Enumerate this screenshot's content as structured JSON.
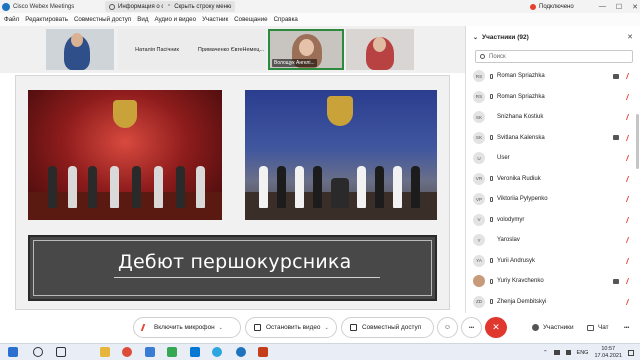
{
  "window": {
    "app_title": "Cisco Webex Meetings",
    "meeting_info": "Информация о совещании",
    "hide_menu": "Скрыть строку меню",
    "connection_status": "Подключено",
    "minimize": "—",
    "maximize": "☐",
    "close": "✕"
  },
  "menu": [
    "Файл",
    "Редактировать",
    "Совместный доступ",
    "Вид",
    "Аудио и видео",
    "Участник",
    "Совещание",
    "Справка"
  ],
  "video_strip": {
    "tiles": [
      {
        "name": ""
      },
      {
        "name": "Наталія Пасічник"
      },
      {
        "name": "Примаченко ЄвгеНемец..."
      },
      {
        "name": "Волощук Ангелі..."
      },
      {
        "name": ""
      }
    ]
  },
  "slide": {
    "title": "Дебют першокурсника"
  },
  "participants": {
    "header": "Участники (92)",
    "search_placeholder": "Поиск",
    "items": [
      {
        "initials": "RS",
        "name": "Roman Spriazhka",
        "device": "phone",
        "camera": true,
        "mic_muted": true
      },
      {
        "initials": "RS",
        "name": "Roman Spriazhka",
        "device": "phone",
        "camera": false,
        "mic_muted": true
      },
      {
        "initials": "SK",
        "name": "Snizhana Kostiuk",
        "device": "",
        "camera": false,
        "mic_muted": true
      },
      {
        "initials": "SK",
        "name": "Svitlana Kalenska",
        "device": "phone",
        "camera": true,
        "mic_muted": true
      },
      {
        "initials": "U",
        "name": "User",
        "device": "",
        "camera": false,
        "mic_muted": true
      },
      {
        "initials": "VR",
        "name": "Veronika Rudiuk",
        "device": "phone",
        "camera": false,
        "mic_muted": true
      },
      {
        "initials": "VP",
        "name": "Viktoriia Pylypenko",
        "device": "phone",
        "camera": false,
        "mic_muted": true
      },
      {
        "initials": "V",
        "name": "volodymyr",
        "device": "phone",
        "camera": false,
        "mic_muted": true
      },
      {
        "initials": "Y",
        "name": "Yaroslav",
        "device": "",
        "camera": false,
        "mic_muted": true
      },
      {
        "initials": "YA",
        "name": "Yurii Andrusyk",
        "device": "phone",
        "camera": false,
        "mic_muted": true
      },
      {
        "initials": "",
        "name": "Yuriy Kravchenko",
        "device": "phone",
        "camera": true,
        "mic_muted": true,
        "photo": true
      },
      {
        "initials": "ZD",
        "name": "Zhenja Dembitskyi",
        "device": "phone",
        "camera": false,
        "mic_muted": true
      }
    ]
  },
  "controls": {
    "mic_label": "Включить микрофон",
    "video_label": "Остановить видео",
    "share_label": "Совместный доступ",
    "participants_label": "Участники",
    "chat_label": "Чат",
    "more": "•••",
    "caret": "⌄"
  },
  "taskbar": {
    "lang": "ENG",
    "time": "10:57",
    "date": "17.04.2021"
  },
  "colors": {
    "end_call": "#e0372f",
    "mic_muted": "#e24a3b",
    "active_speaker_border": "#2b8a3e",
    "slide_title_bg": "#484848"
  }
}
